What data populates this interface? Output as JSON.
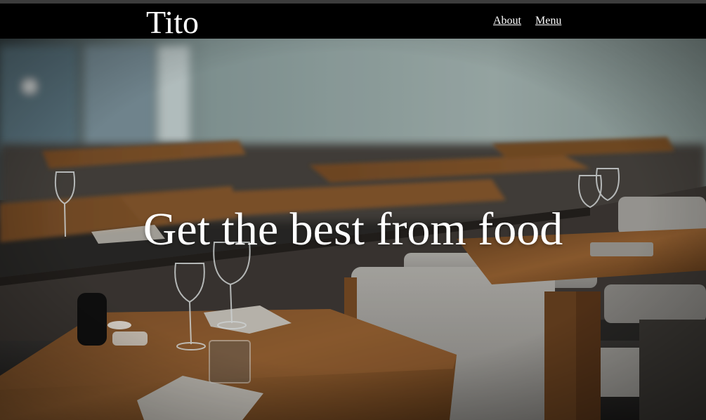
{
  "header": {
    "brand": "Tito",
    "nav": [
      {
        "label": "About"
      },
      {
        "label": "Menu"
      }
    ]
  },
  "hero": {
    "title": "Get the best from food",
    "background_image": "restaurant-interior-photo"
  },
  "colors": {
    "header_bg": "#000000",
    "text": "#ffffff",
    "wood": "#8a5a2e",
    "seat": "#b9b7b2"
  }
}
